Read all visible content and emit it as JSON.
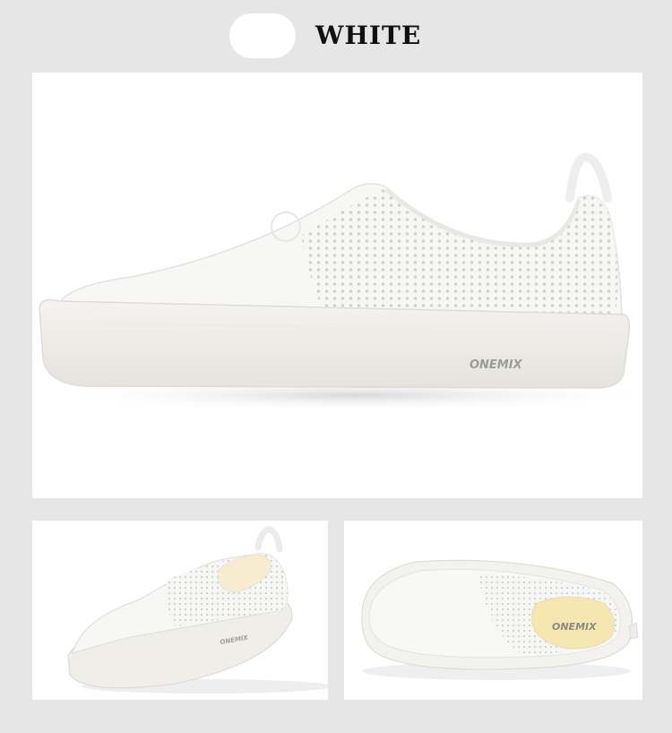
{
  "color_option": {
    "label": "WHITE",
    "swatch_color": "#ffffff"
  },
  "brand_logo": "ONEMIX",
  "photos": [
    {
      "name": "shoe-side-view-large"
    },
    {
      "name": "shoe-three-quarter-view"
    },
    {
      "name": "shoe-top-view"
    }
  ]
}
